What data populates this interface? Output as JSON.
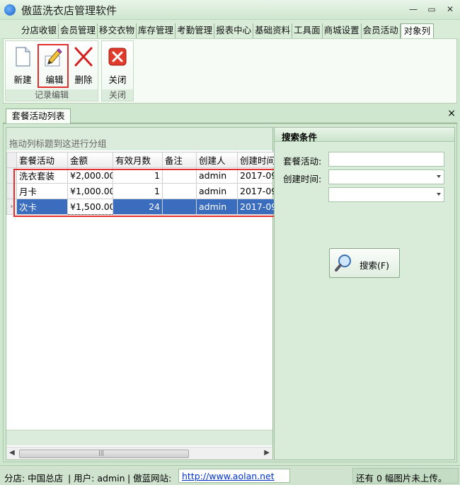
{
  "window": {
    "title": "傲蓝洗衣店管理软件",
    "min": "—",
    "max": "▭",
    "close": "✕"
  },
  "menu": {
    "tabs": [
      "分店收银",
      "会员管理",
      "移交衣物",
      "库存管理",
      "考勤管理",
      "报表中心",
      "基础资料",
      "工具面",
      "商城设置",
      "会员活动",
      "对象列"
    ]
  },
  "ribbon": {
    "groups": [
      {
        "label": "记录编辑",
        "buttons": [
          {
            "label": "新建"
          },
          {
            "label": "编辑"
          },
          {
            "label": "删除"
          }
        ]
      },
      {
        "label": "关闭",
        "buttons": [
          {
            "label": "关闭"
          }
        ]
      }
    ]
  },
  "doctab": {
    "label": "套餐活动列表",
    "close": "×"
  },
  "grid": {
    "group_hint": "拖动列标题到这进行分组",
    "columns": [
      "套餐活动",
      "金额",
      "有效月数",
      "备注",
      "创建人",
      "创建时间"
    ],
    "rows": [
      {
        "name": "洗衣套装",
        "amount": "¥2,000.00",
        "months": "1",
        "note": "",
        "creator": "admin",
        "created": "2017-09-"
      },
      {
        "name": "月卡",
        "amount": "¥1,000.00",
        "months": "1",
        "note": "",
        "creator": "admin",
        "created": "2017-09-"
      },
      {
        "name": "次卡",
        "amount": "¥1,500.00",
        "months": "24",
        "note": "",
        "creator": "admin",
        "created": "2017-09-"
      }
    ],
    "current_row_marker": "›",
    "scroll_left": "◀",
    "scroll_right": "▶",
    "scroll_grip": "|||"
  },
  "search": {
    "title": "搜索条件",
    "activity_label": "套餐活动:",
    "activity_value": "",
    "time_label": "创建时间:",
    "time_from": "",
    "time_to": "",
    "button": "搜索(F)"
  },
  "status": {
    "branch": "分店: 中国总店",
    "user": "| 用户: admin",
    "site_label": "| 傲蓝网站:",
    "site_url": "http://www.aolan.net",
    "upload": "还有 0 幅图片未上传。"
  }
}
